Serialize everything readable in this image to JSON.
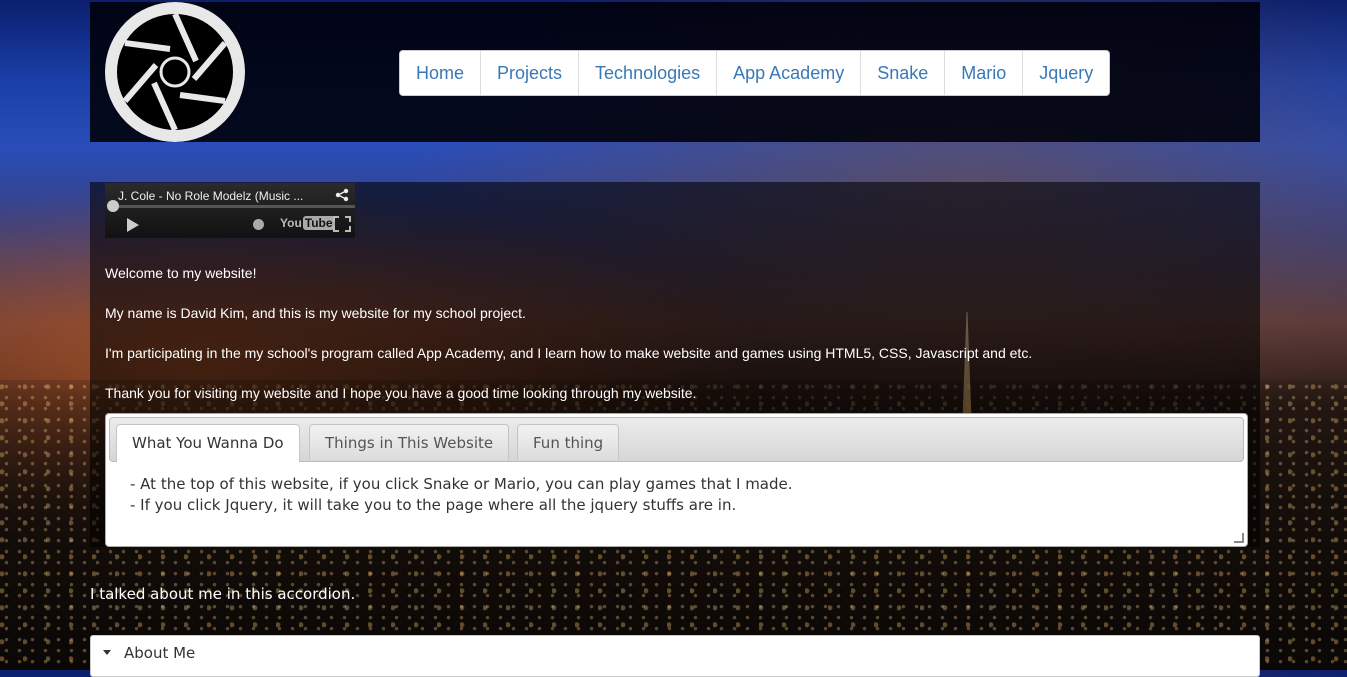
{
  "nav": {
    "items": [
      "Home",
      "Projects",
      "Technologies",
      "App Academy",
      "Snake",
      "Mario",
      "Jquery"
    ]
  },
  "video": {
    "title": "J. Cole - No Role Modelz (Music ...",
    "brand": "You",
    "brand_box": "Tube"
  },
  "intro": {
    "welcome": "Welcome to my website!",
    "name": "My name is David Kim, and this is my website for my school project.",
    "program": "I'm participating in the my school's program called App Academy, and I learn how to make website and games using HTML5, CSS, Javascript and etc.",
    "thanks": "Thank you for visiting my website and I hope you have a good time looking through my website."
  },
  "tabs": {
    "labels": [
      "What You Wanna Do",
      "Things in This Website",
      "Fun thing"
    ],
    "content": [
      "- At the top of this website, if you click Snake or Mario, you can play games that I made.",
      "- If you click Jquery, it will take you to the page where all the jquery stuffs are in."
    ]
  },
  "caption": "I talked about me in this accordion.",
  "accordion": {
    "label": "About Me"
  },
  "icons": [
    "aperture-logo-icon",
    "share-icon",
    "play-icon",
    "clock-icon",
    "fullscreen-icon",
    "caret-down-icon"
  ],
  "colors": {
    "nav_link": "#3a78b5",
    "header_bg": "#000008"
  }
}
